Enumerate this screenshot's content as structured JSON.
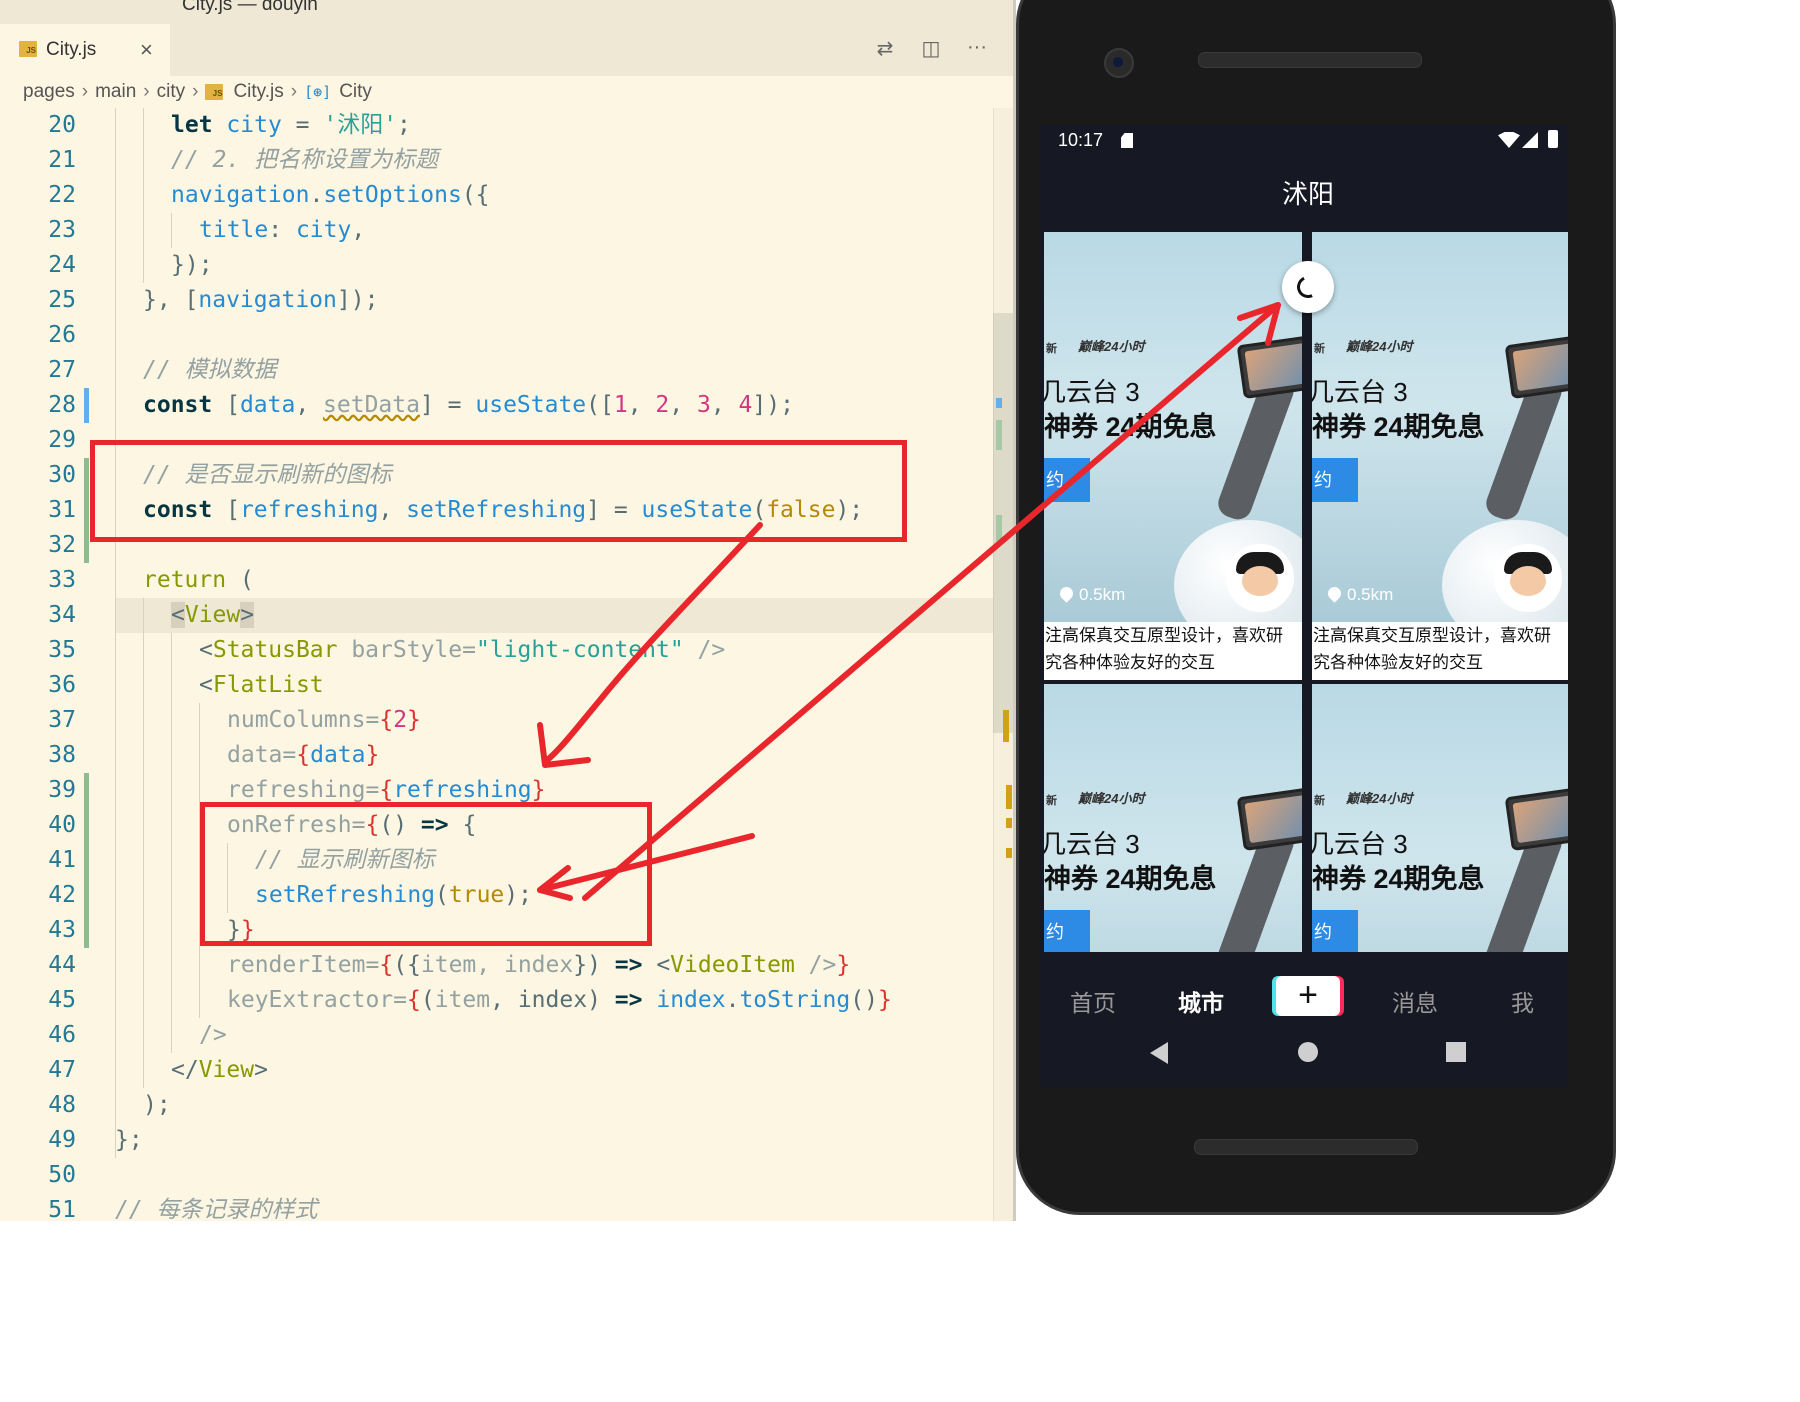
{
  "window": {
    "title": "City.js — douyin"
  },
  "editor": {
    "tab": {
      "badge": "JS",
      "label": "City.js",
      "close": "×"
    },
    "breadcrumb": [
      "pages",
      "main",
      "city",
      "City.js",
      "City"
    ],
    "line_numbers": [
      "20",
      "21",
      "22",
      "23",
      "24",
      "25",
      "26",
      "27",
      "28",
      "29",
      "30",
      "31",
      "32",
      "33",
      "34",
      "35",
      "36",
      "37",
      "38",
      "39",
      "40",
      "41",
      "42",
      "43",
      "44",
      "45",
      "46",
      "47",
      "48",
      "49",
      "50",
      "51"
    ],
    "code": {
      "l20": {
        "kw": "let",
        "var": "city",
        "eq": " = ",
        "str": "'沭阳'",
        "end": ";"
      },
      "l21": {
        "cmt": "// 2. 把名称设置为标题"
      },
      "l22": {
        "obj": "navigation",
        "dot": ".",
        "fn": "setOptions",
        "rest": "({"
      },
      "l23": {
        "key": "title",
        "colon": ": ",
        "val": "city",
        "end": ","
      },
      "l24": {
        "text": "});"
      },
      "l25": {
        "a": "}, [",
        "b": "navigation",
        "c": "]);"
      },
      "l27": {
        "cmt": "// 模拟数据"
      },
      "l28": {
        "kw": "const",
        "a": " [",
        "v1": "data",
        "c": ", ",
        "v2": "setData",
        "d": "] = ",
        "fn": "useState",
        "e": "([",
        "n1": "1",
        "n2": "2",
        "n3": "3",
        "n4": "4",
        "f": "]);"
      },
      "l30": {
        "cmt": "// 是否显示刷新的图标"
      },
      "l31": {
        "kw": "const",
        "a": " [",
        "v1": "refreshing",
        "c": ", ",
        "v2": "setRefreshing",
        "d": "] = ",
        "fn": "useState",
        "e": "(",
        "b": "false",
        "f": ");"
      },
      "l33": {
        "kw": "return",
        "rest": " ("
      },
      "l34": {
        "lt": "<",
        "tag": "View",
        "gt": ">"
      },
      "l35": {
        "lt": "<",
        "tag": "StatusBar",
        "attr": " barStyle=",
        "str": "\"light-content\"",
        "end": " />"
      },
      "l36": {
        "lt": "<",
        "tag": "FlatList"
      },
      "l37": {
        "attr": "numColumns=",
        "b1": "{",
        "num": "2",
        "b2": "}"
      },
      "l38": {
        "attr": "data=",
        "b1": "{",
        "var": "data",
        "b2": "}"
      },
      "l39": {
        "attr": "refreshing=",
        "b1": "{",
        "var": "refreshing",
        "b2": "}"
      },
      "l40": {
        "attr": "onRefresh=",
        "b1": "{",
        "rest": "() ",
        "arrow": "=>",
        "end": " {"
      },
      "l41": {
        "cmt": "// 显示刷新图标"
      },
      "l42": {
        "fn": "setRefreshing",
        "a": "(",
        "b": "true",
        "c": ");"
      },
      "l43": {
        "a": "}",
        "b": "}"
      },
      "l44": {
        "attr": "renderItem=",
        "b1": "{",
        "a": "({",
        "p": "item, index",
        "c": "}) ",
        "arrow": "=>",
        "d": " <",
        "tag": "VideoItem",
        "e": " />",
        "b2": "}"
      },
      "l45": {
        "attr": "keyExtractor=",
        "b1": "{",
        "a": "(",
        "p1": "item",
        "c": ", ",
        "p2": "index",
        "d": ") ",
        "arrow": "=>",
        "sp": " ",
        "var": "index",
        "dot": ".",
        "fn": "toString",
        "e": "()",
        "b2": "}"
      },
      "l46": {
        "text": "/>"
      },
      "l47": {
        "lt": "</",
        "tag": "View",
        "gt": ">"
      },
      "l48": {
        "text": ");"
      },
      "l49": {
        "text": "};"
      },
      "l51": {
        "cmt": "// 每条记录的样式"
      }
    }
  },
  "phone": {
    "status": {
      "time": "10:17"
    },
    "header_title": "沭阳",
    "cards": [
      {
        "brand": "新",
        "brand2": "巅峰24小时",
        "line1": "几云台 3",
        "line2": "神券 24期免息",
        "btn": "约",
        "distance": "0.5km",
        "desc1": "注高保真交互原型设计，喜欢研",
        "desc2": "究各种体验友好的交互"
      },
      {
        "brand": "新",
        "brand2": "巅峰24小时",
        "line1": "几云台 3",
        "line2": "神券 24期免息",
        "btn": "约",
        "distance": "0.5km",
        "desc1": "注高保真交互原型设计，喜欢研",
        "desc2": "究各种体验友好的交互"
      },
      {
        "brand": "新",
        "brand2": "巅峰24小时",
        "line1": "几云台 3",
        "line2": "神券 24期免息",
        "btn": "约"
      },
      {
        "brand": "新",
        "brand2": "巅峰24小时",
        "line1": "几云台 3",
        "line2": "神券 24期免息",
        "btn": "约"
      }
    ],
    "tabbar": {
      "home": "首页",
      "city": "城市",
      "plus": "+",
      "messages": "消息",
      "me": "我"
    }
  },
  "colors": {
    "annotation": "#e8262b",
    "editor_bg": "#fdf6e3",
    "app_bg": "#161823"
  }
}
